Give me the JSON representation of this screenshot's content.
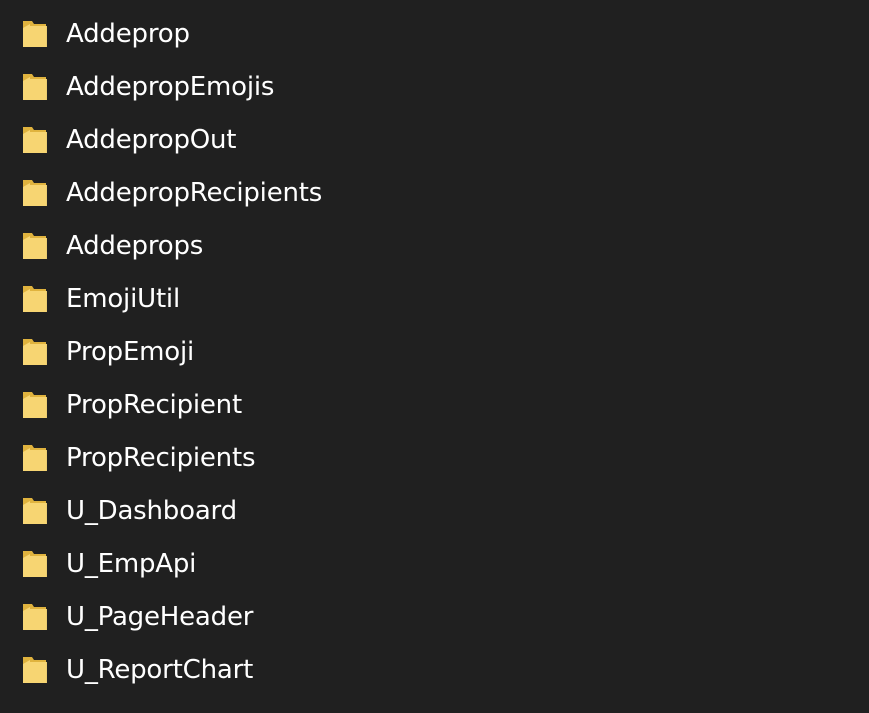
{
  "folders": [
    {
      "name": "Addeprop",
      "icon": "folder-icon"
    },
    {
      "name": "AddepropEmojis",
      "icon": "folder-icon"
    },
    {
      "name": "AddepropOut",
      "icon": "folder-icon"
    },
    {
      "name": "AddepropRecipients",
      "icon": "folder-icon"
    },
    {
      "name": "Addeprops",
      "icon": "folder-icon"
    },
    {
      "name": "EmojiUtil",
      "icon": "folder-icon"
    },
    {
      "name": "PropEmoji",
      "icon": "folder-icon"
    },
    {
      "name": "PropRecipient",
      "icon": "folder-icon"
    },
    {
      "name": "PropRecipients",
      "icon": "folder-icon"
    },
    {
      "name": "U_Dashboard",
      "icon": "folder-icon"
    },
    {
      "name": "U_EmpApi",
      "icon": "folder-icon"
    },
    {
      "name": "U_PageHeader",
      "icon": "folder-icon"
    },
    {
      "name": "U_ReportChart",
      "icon": "folder-icon"
    }
  ],
  "colors": {
    "background": "#202020",
    "text": "#ffffff",
    "folder_front": "#F8D775",
    "folder_back": "#E0B33E"
  }
}
